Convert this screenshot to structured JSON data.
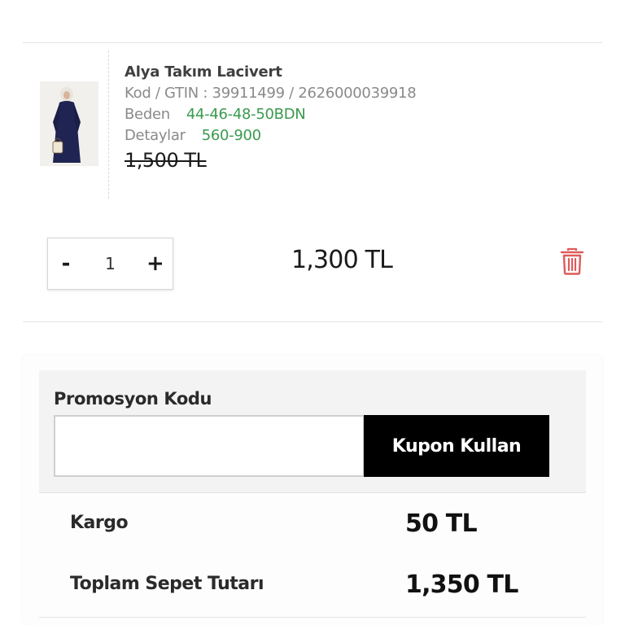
{
  "product": {
    "name": "Alya Takım Lacivert",
    "code_line": "Kod / GTIN : 39911499 / 2626000039918",
    "size_label": "Beden",
    "size_value": "44-46-48-50BDN",
    "details_label": "Detaylar",
    "details_value": "560-900",
    "old_price": "1,500 TL",
    "image_icon": "product-photo"
  },
  "cart_item": {
    "decrement_label": "-",
    "quantity": "1",
    "increment_label": "+",
    "price": "1,300 TL",
    "delete_icon": "trash-icon"
  },
  "promo": {
    "label": "Promosyon Kodu",
    "input_value": "",
    "input_placeholder": "",
    "button_label": "Kupon Kullan"
  },
  "summary": {
    "shipping_label": "Kargo",
    "shipping_value": "50 TL",
    "total_label": "Toplam Sepet Tutarı",
    "total_value": "1,350 TL"
  },
  "colors": {
    "accent_green": "#3a9a4e",
    "delete_red": "#e05a5a",
    "button_black": "#000000",
    "navy_dress": "#1f2452"
  }
}
